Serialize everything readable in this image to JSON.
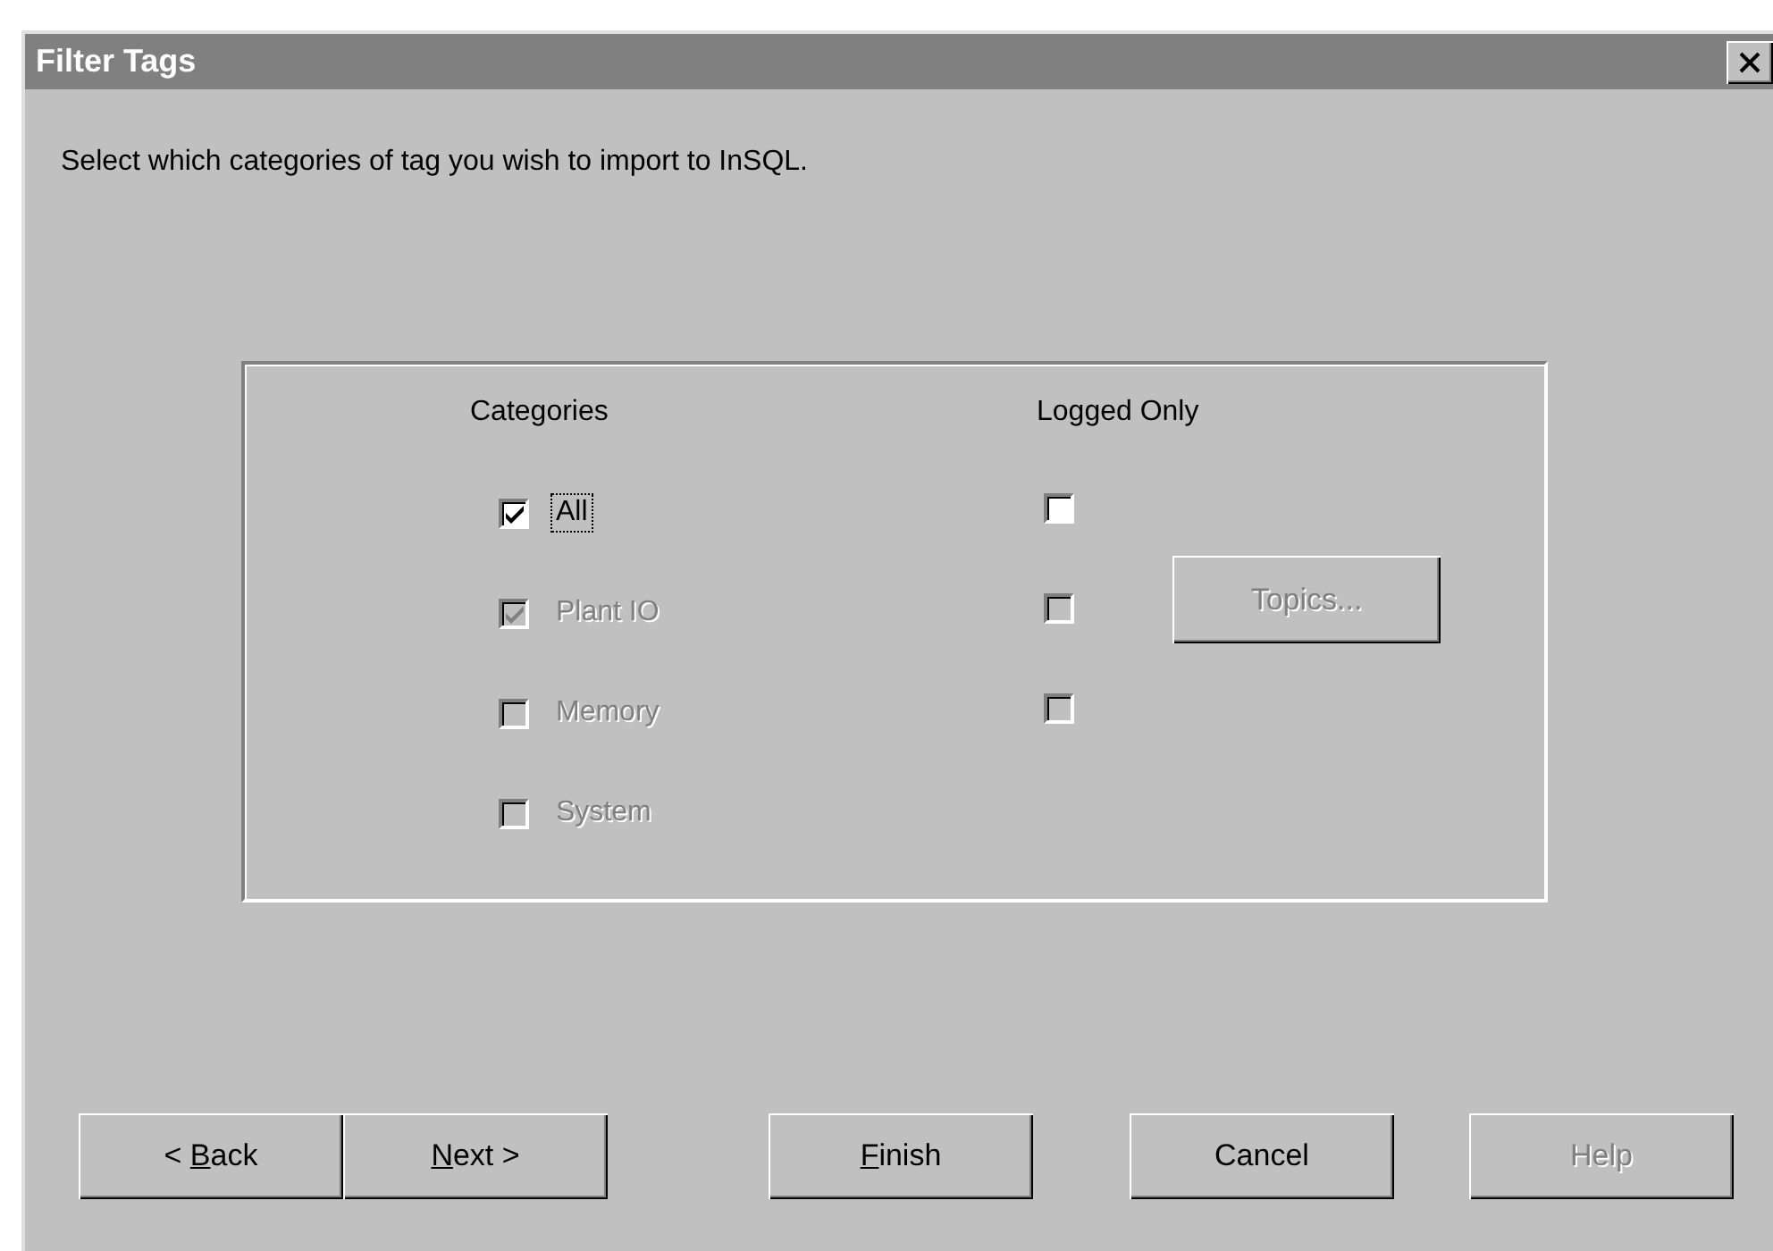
{
  "window": {
    "title": "Filter Tags"
  },
  "instruction": "Select which categories of tag you wish to import to InSQL.",
  "categories": {
    "heading": "Categories",
    "items": [
      {
        "label": "All",
        "checked": true,
        "disabled": false,
        "focused": true
      },
      {
        "label": "Plant IO",
        "checked": true,
        "disabled": true,
        "focused": false
      },
      {
        "label": "Memory",
        "checked": false,
        "disabled": true,
        "focused": false
      },
      {
        "label": "System",
        "checked": false,
        "disabled": true,
        "focused": false
      }
    ]
  },
  "logged_only": {
    "heading": "Logged Only",
    "items": [
      {
        "checked": false,
        "disabled": false
      },
      {
        "checked": false,
        "disabled": true
      },
      {
        "checked": false,
        "disabled": true
      }
    ]
  },
  "topics_button": {
    "label": "Topics...",
    "disabled": true
  },
  "buttons": [
    {
      "label_start": "< ",
      "access_key": "B",
      "label_end": "ack",
      "disabled": false
    },
    {
      "access_key": "N",
      "label_end": "ext >",
      "disabled": false
    },
    {
      "access_key": "F",
      "label_end": "inish",
      "disabled": false
    },
    {
      "label_start": "Cancel",
      "disabled": false
    },
    {
      "label_start": "Help",
      "disabled": true
    }
  ]
}
